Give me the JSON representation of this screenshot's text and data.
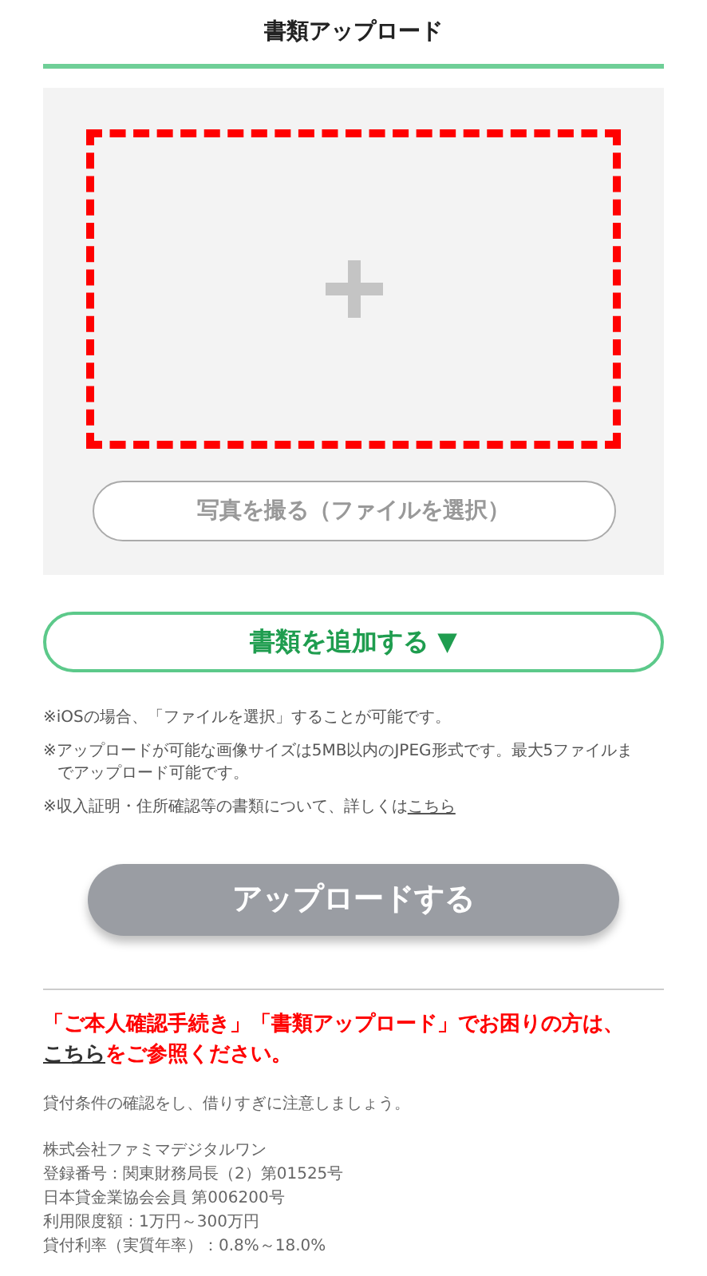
{
  "header": {
    "title": "書類アップロード"
  },
  "upload_panel": {
    "photo_button": "写真を撮る（ファイルを選択）"
  },
  "add_button": {
    "label": "書類を追加する",
    "caret": "▼"
  },
  "notes": [
    {
      "text": "※iOSの場合、「ファイルを選択」することが可能です。"
    },
    {
      "text": "※アップロードが可能な画像サイズは5MB以内のJPEG形式です。最大5ファイルまでアップロード可能です。"
    },
    {
      "text": "※収入証明・住所確認等の書類について、詳しくは",
      "link": "こちら"
    }
  ],
  "upload_button": {
    "label": "アップロードする",
    "disabled": true
  },
  "notice": {
    "before": "「ご本人確認手続き」「書類アップロード」でお困りの方は、",
    "link": "こちら",
    "after": "をご参照ください。"
  },
  "caution": "貸付条件の確認をし、借りすぎに注意しましょう。",
  "company_lines": [
    "株式会社ファミマデジタルワン",
    "登録番号：関東財務局長（2）第01525号",
    "日本貸金業協会会員 第006200号",
    "利用限度額：1万円～300万円",
    "貸付利率（実質年率）：0.8%～18.0%"
  ]
}
